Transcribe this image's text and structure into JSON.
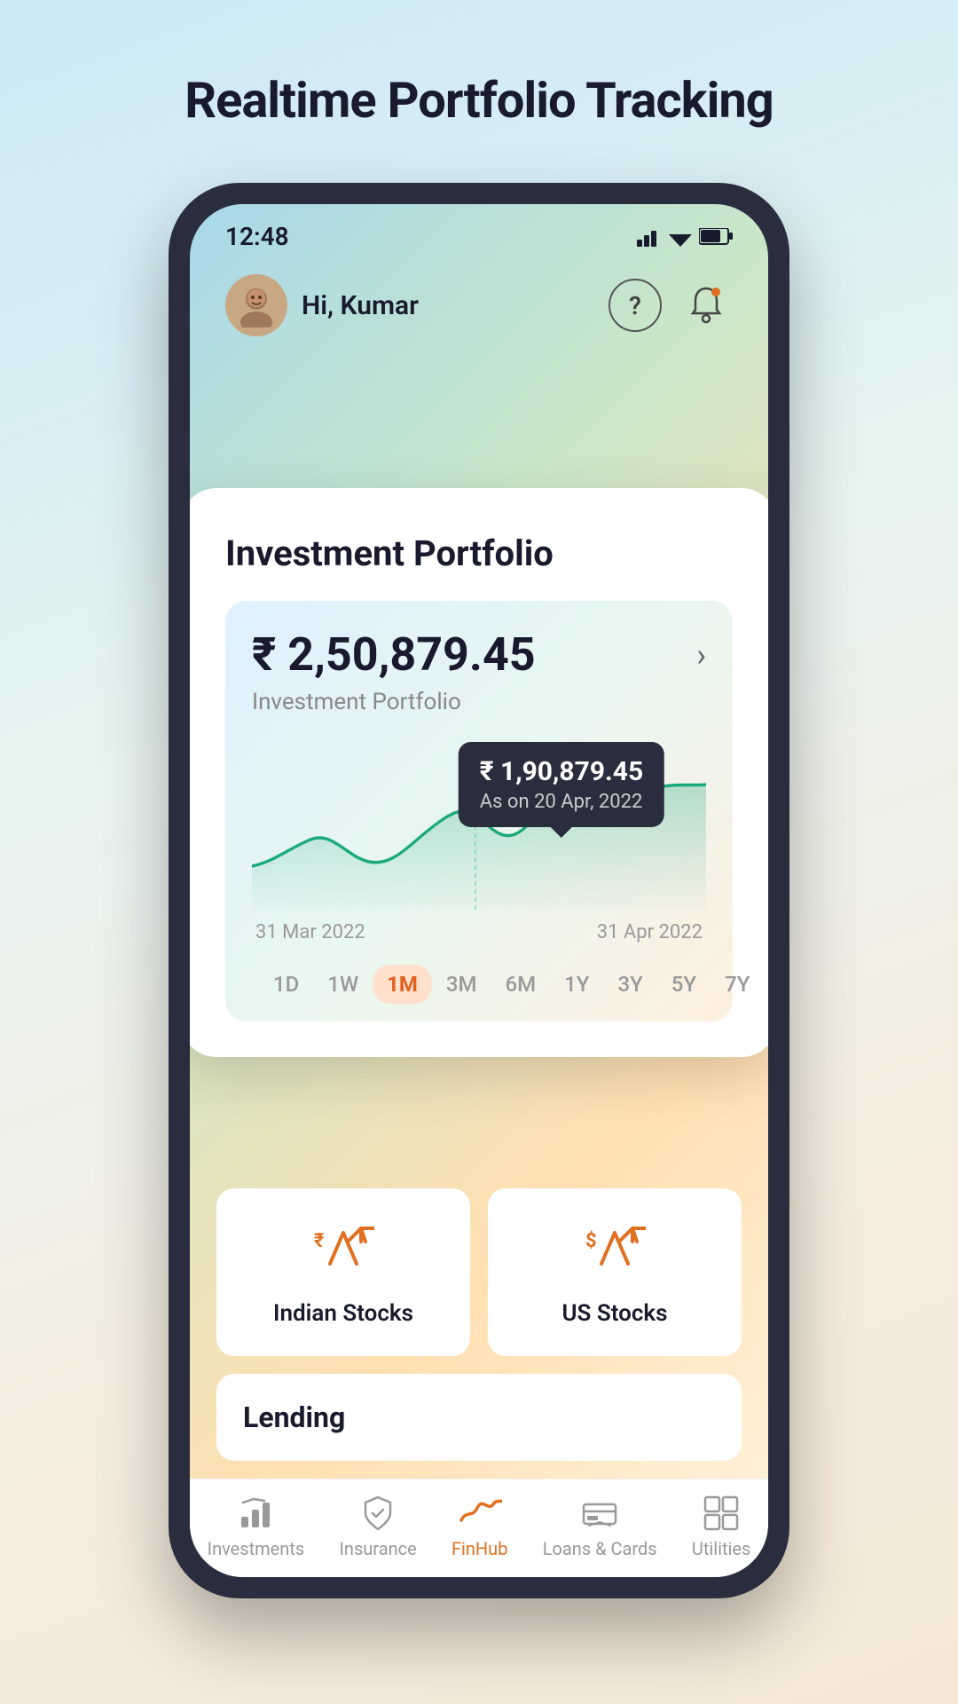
{
  "page": {
    "title": "Realtime Portfolio Tracking",
    "background_gradient": "linear-gradient(160deg, #cce8f4, #f5e8d8)"
  },
  "status_bar": {
    "time": "12:48"
  },
  "top_nav": {
    "greeting": "Hi, Kumar",
    "help_icon": "?",
    "bell_icon": "🔔"
  },
  "portfolio_card": {
    "title": "Investment Portfolio",
    "total_value": "₹ 2,50,879.45",
    "subtitle": "Investment Portfolio",
    "tooltip": {
      "value": "₹ 1,90,879.45",
      "date": "As on 20 Apr, 2022"
    },
    "chart": {
      "date_start": "31 Mar 2022",
      "date_end": "31 Apr 2022",
      "time_periods": [
        "1D",
        "1W",
        "1M",
        "3M",
        "6M",
        "1Y",
        "3Y",
        "5Y",
        "7Y"
      ],
      "active_period": "1M"
    }
  },
  "categories": [
    {
      "name": "Indian Stocks",
      "icon": "📈"
    },
    {
      "name": "US Stocks",
      "icon": "📈"
    }
  ],
  "lending_section": {
    "title": "Lending"
  },
  "bottom_nav": {
    "items": [
      {
        "label": "Investments",
        "icon": "investments",
        "active": false
      },
      {
        "label": "Insurance",
        "icon": "insurance",
        "active": false
      },
      {
        "label": "FinHub",
        "icon": "finhub",
        "active": true
      },
      {
        "label": "Loans & Cards",
        "icon": "loans",
        "active": false
      },
      {
        "label": "Utilities",
        "icon": "utilities",
        "active": false
      }
    ]
  }
}
